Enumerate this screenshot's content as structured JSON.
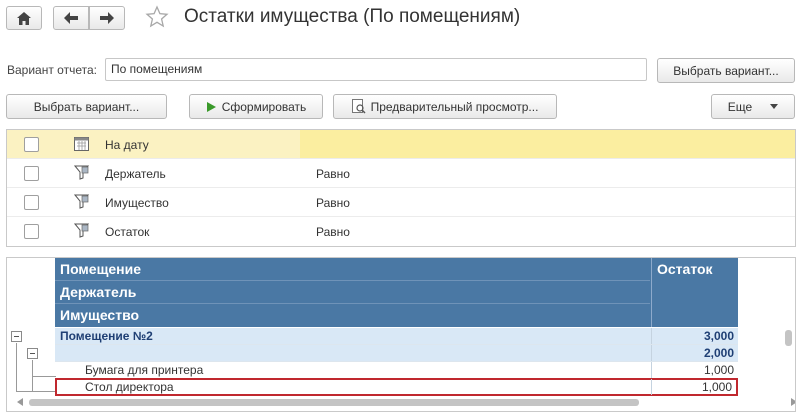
{
  "window": {
    "title": "Остатки имущества (По помещениям)"
  },
  "toolbar": {
    "home_icon": "home-icon",
    "back_icon": "arrow-left-icon",
    "forward_icon": "arrow-right-icon",
    "favorite_icon": "star-icon"
  },
  "variant": {
    "label": "Вариант отчета:",
    "value": "По помещениям",
    "select_button": "Выбрать вариант..."
  },
  "actions": {
    "select_variant": "Выбрать вариант...",
    "generate": "Сформировать",
    "preview": "Предварительный просмотр...",
    "more": "Еще"
  },
  "settings": [
    {
      "name": "На дату",
      "value": "",
      "icon": "calendar-icon",
      "selected": true
    },
    {
      "name": "Держатель",
      "value": "Равно",
      "icon": "filter-icon",
      "selected": false
    },
    {
      "name": "Имущество",
      "value": "Равно",
      "icon": "filter-icon",
      "selected": false
    },
    {
      "name": "Остаток",
      "value": "Равно",
      "icon": "filter-icon",
      "selected": false
    }
  ],
  "report": {
    "headers": [
      "Помещение",
      "Держатель",
      "Имущество"
    ],
    "value_header": "Остаток",
    "rows": [
      {
        "name": "Помещение №2",
        "value": "3,000"
      },
      {
        "name": "",
        "value": "2,000"
      },
      {
        "name": "Бумага для принтера",
        "value": "1,000"
      },
      {
        "name": "Стол директора",
        "value": "1,000"
      }
    ]
  },
  "colors": {
    "header_bg": "#4a78a4",
    "group_bg": "#d9e8f6",
    "selected_row": "#fbf2c2",
    "highlight_border": "#c0282e"
  }
}
